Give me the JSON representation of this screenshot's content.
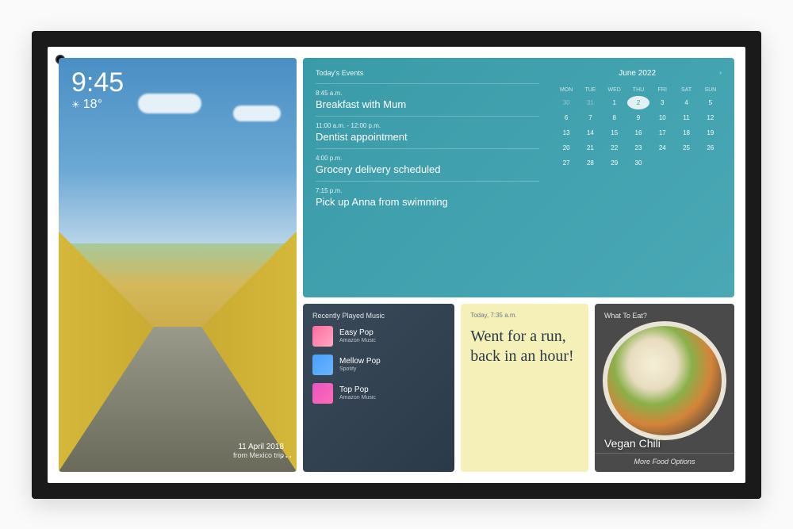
{
  "time": "9:45",
  "temperature": "18°",
  "weather_icon": "☀",
  "photo": {
    "date": "11 April 2018",
    "source": "from Mexico trip"
  },
  "events": {
    "heading": "Today's Events",
    "items": [
      {
        "time": "8:45 a.m.",
        "title": "Breakfast with Mum"
      },
      {
        "time": "11:00 a.m. - 12:00 p.m.",
        "title": "Dentist appointment"
      },
      {
        "time": "4:00 p.m.",
        "title": "Grocery delivery scheduled"
      },
      {
        "time": "7:15 p.m.",
        "title": "Pick up Anna from swimming"
      }
    ]
  },
  "calendar": {
    "month": "June 2022",
    "dow": [
      "MON",
      "TUE",
      "WED",
      "THU",
      "FRI",
      "SAT",
      "SUN"
    ],
    "leading_dim": [
      30,
      31
    ],
    "today": 2,
    "last_day": 30
  },
  "music": {
    "heading": "Recently Played Music",
    "items": [
      {
        "title": "Easy Pop",
        "source": "Amazon Music"
      },
      {
        "title": "Mellow Pop",
        "source": "Spotify"
      },
      {
        "title": "Top Pop",
        "source": "Amazon Music"
      }
    ]
  },
  "note": {
    "heading": "Today, 7:35 a.m.",
    "text": "Went for a run, back in an hour!"
  },
  "food": {
    "heading": "What To Eat?",
    "name": "Vegan Chili",
    "more": "More Food Options"
  }
}
